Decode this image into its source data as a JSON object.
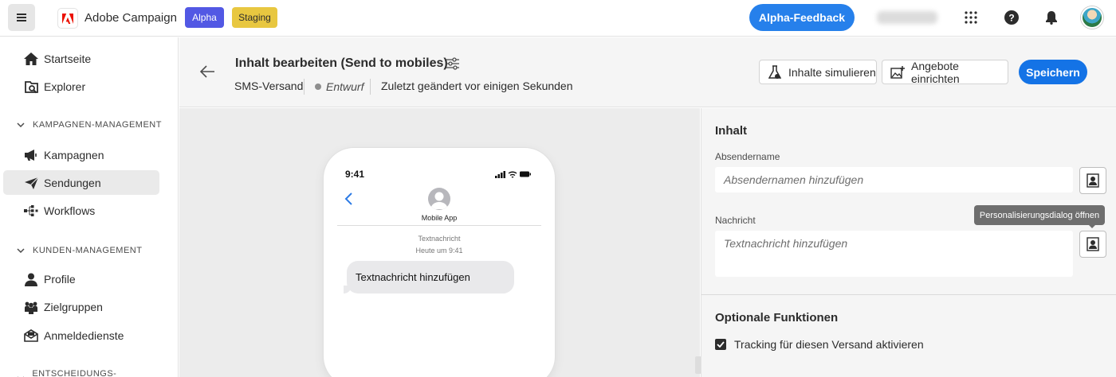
{
  "topbar": {
    "app_title": "Adobe Campaign",
    "badge_alpha": "Alpha",
    "badge_staging": "Staging",
    "feedback_label": "Alpha-Feedback",
    "icons": [
      "apps-grid-icon",
      "help-icon",
      "notification-bell-icon",
      "user-avatar"
    ]
  },
  "sidebar": {
    "items_top": [
      {
        "label": "Startseite",
        "icon": "home-icon"
      },
      {
        "label": "Explorer",
        "icon": "explorer-icon"
      }
    ],
    "sections": [
      {
        "title": "KAMPAGNEN-MANAGEMENT",
        "items": [
          {
            "label": "Kampagnen",
            "icon": "megaphone-icon"
          },
          {
            "label": "Sendungen",
            "icon": "send-icon",
            "active": true
          },
          {
            "label": "Workflows",
            "icon": "workflow-icon"
          }
        ]
      },
      {
        "title": "KUNDEN-MANAGEMENT",
        "items": [
          {
            "label": "Profile",
            "icon": "user-icon"
          },
          {
            "label": "Zielgruppen",
            "icon": "audiences-icon"
          },
          {
            "label": "Anmeldedienste",
            "icon": "subscription-icon"
          }
        ]
      },
      {
        "title": "ENTSCHEIDUNGS- MANAGEMENT"
      }
    ]
  },
  "header": {
    "title": "Inhalt bearbeiten",
    "title_suffix": "(Send to mobiles)",
    "channel": "SMS-Versand",
    "status": "Entwurf",
    "modified": "Zuletzt geändert vor einigen Sekunden",
    "simulate_label": "Inhalte simulieren",
    "offers_label": "Angebote einrichten",
    "save_label": "Speichern"
  },
  "phone": {
    "time": "9:41",
    "contact_name": "Mobile App",
    "meta_type": "Textnachricht",
    "meta_time": "Heute um 9:41",
    "bubble_text": "Textnachricht hinzufügen"
  },
  "panel": {
    "content_title": "Inhalt",
    "sender_label": "Absendername",
    "sender_placeholder": "Absendernamen hinzufügen",
    "message_label": "Nachricht",
    "message_placeholder": "Textnachricht hinzufügen",
    "tooltip": "Personalisierungsdialog öffnen",
    "optional_title": "Optionale Funktionen",
    "tracking_label": "Tracking für diesen Versand aktivieren",
    "tracking_checked": true
  },
  "colors": {
    "primary_blue": "#1473e6",
    "feedback_blue": "#2680eb",
    "alpha_badge": "#5258e4",
    "staging_badge": "#e8c740"
  }
}
